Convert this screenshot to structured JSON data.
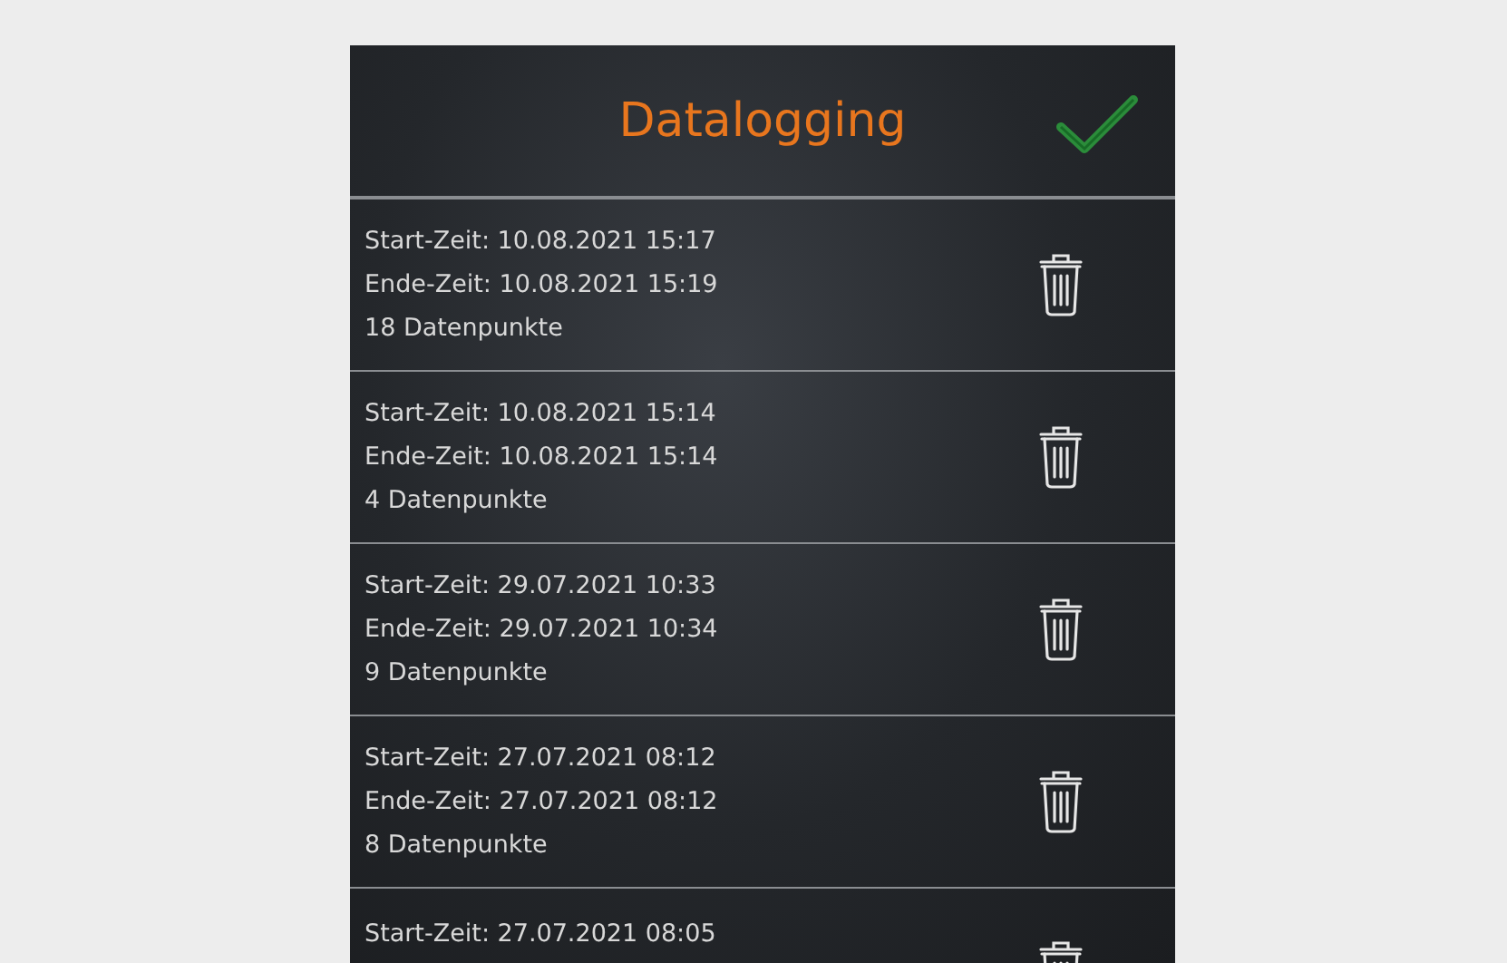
{
  "header": {
    "title": "Datalogging"
  },
  "logs": [
    {
      "start": "Start-Zeit: 10.08.2021 15:17",
      "end": "Ende-Zeit: 10.08.2021 15:19",
      "points": "18 Datenpunkte"
    },
    {
      "start": "Start-Zeit: 10.08.2021 15:14",
      "end": "Ende-Zeit: 10.08.2021 15:14",
      "points": "4 Datenpunkte"
    },
    {
      "start": "Start-Zeit: 29.07.2021 10:33",
      "end": "Ende-Zeit: 29.07.2021 10:34",
      "points": "9 Datenpunkte"
    },
    {
      "start": "Start-Zeit: 27.07.2021 08:12",
      "end": "Ende-Zeit: 27.07.2021 08:12",
      "points": "8 Datenpunkte"
    },
    {
      "start": "Start-Zeit: 27.07.2021 08:05"
    }
  ]
}
